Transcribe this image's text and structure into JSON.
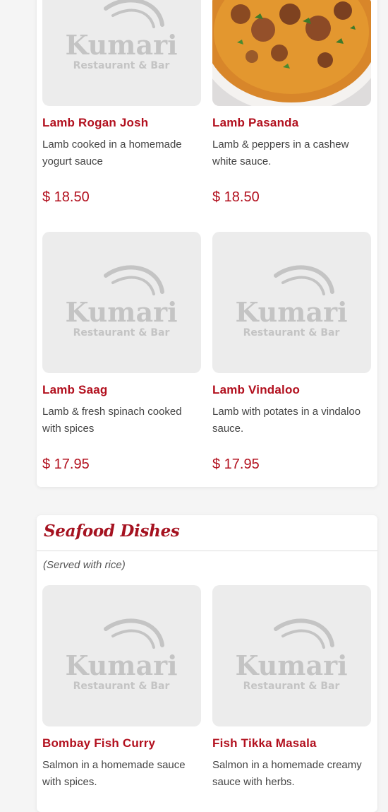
{
  "logo": {
    "line1": "Kumari",
    "line2": "Restaurant & Bar"
  },
  "lamb_section": {
    "items": [
      {
        "name": "Lamb Rogan Josh",
        "description": "Lamb cooked in a homemade yogurt sauce",
        "price": "$ 18.50",
        "image": "placeholder-logo"
      },
      {
        "name": "Lamb Pasanda",
        "description": "Lamb & peppers in a cashew white sauce.",
        "price": "$ 18.50",
        "image": "curry-photo"
      },
      {
        "name": "Lamb Saag",
        "description": "Lamb & fresh spinach cooked with spices",
        "price": "$ 17.95",
        "image": "placeholder-logo"
      },
      {
        "name": "Lamb Vindaloo",
        "description": "Lamb with potates in a vindaloo sauce.",
        "price": "$ 17.95",
        "image": "placeholder-logo"
      }
    ]
  },
  "seafood_section": {
    "title": "Seafood Dishes",
    "note": "(Served with rice)",
    "items": [
      {
        "name": "Bombay Fish Curry",
        "description": "Salmon in a homemade sauce with spices.",
        "image": "placeholder-logo"
      },
      {
        "name": "Fish Tikka Masala",
        "description": "Salmon in a homemade creamy sauce with herbs.",
        "image": "placeholder-logo"
      }
    ]
  },
  "colors": {
    "accent": "#b2101e",
    "placeholder_bg": "#ececec",
    "logo_gray": "#c4c4c4"
  }
}
